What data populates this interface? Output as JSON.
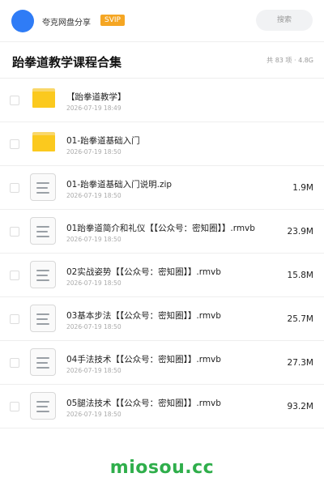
{
  "header": {
    "brand": "夸克网盘分享",
    "badge": "SVIP",
    "search_label": "搜索"
  },
  "page": {
    "title": "跆拳道教学课程合集",
    "stats": "共 83 项 · 4.8G"
  },
  "files": [
    {
      "type": "folder",
      "name": "【跆拳道教学】",
      "date": "2026-07-19 18:49",
      "size": ""
    },
    {
      "type": "folder",
      "name": "01-跆拳道基础入门",
      "date": "2026-07-19 18:50",
      "size": ""
    },
    {
      "type": "file",
      "name": "01-跆拳道基础入门说明.zip",
      "date": "2026-07-19 18:50",
      "size": "1.9M"
    },
    {
      "type": "file",
      "name": "01跆拳道简介和礼仪【【公众号：密知圈】】.rmvb",
      "date": "2026-07-19 18:50",
      "size": "23.9M"
    },
    {
      "type": "file",
      "name": "02实战姿势【【公众号：密知圈】】.rmvb",
      "date": "2026-07-19 18:50",
      "size": "15.8M"
    },
    {
      "type": "file",
      "name": "03基本步法【【公众号：密知圈】】.rmvb",
      "date": "2026-07-19 18:50",
      "size": "25.7M"
    },
    {
      "type": "file",
      "name": "04手法技术【【公众号：密知圈】】.rmvb",
      "date": "2026-07-19 18:50",
      "size": "27.3M"
    },
    {
      "type": "file",
      "name": "05腿法技术【【公众号：密知圈】】.rmvb",
      "date": "2026-07-19 18:50",
      "size": "93.2M"
    }
  ],
  "footer": {
    "watermark": "miosou.cc"
  }
}
